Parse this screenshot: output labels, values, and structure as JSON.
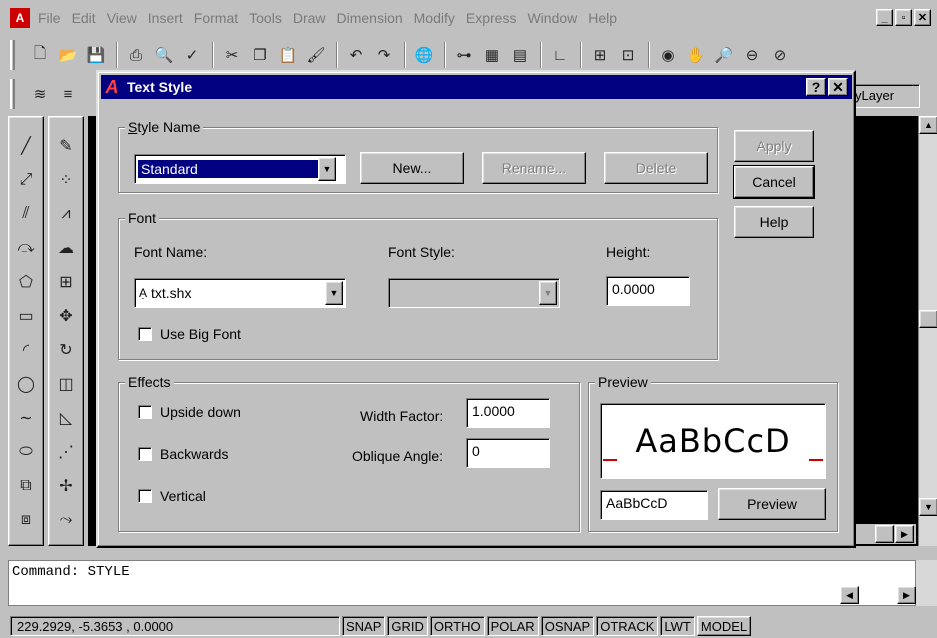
{
  "menubar": {
    "items": [
      "File",
      "Edit",
      "View",
      "Insert",
      "Format",
      "Tools",
      "Draw",
      "Dimension",
      "Modify",
      "Express",
      "Window",
      "Help"
    ],
    "window_buttons": [
      "_",
      "▫",
      "✕"
    ]
  },
  "layer_combo": {
    "value": "yLayer"
  },
  "dialog": {
    "title": "Text Style",
    "help_btn": "?",
    "close_btn": "✕",
    "style_name": {
      "group_label": "Style Name",
      "value": "Standard",
      "new_label": "New...",
      "rename_label": "Rename...",
      "delete_label": "Delete"
    },
    "side_buttons": {
      "apply": "Apply",
      "cancel": "Cancel",
      "help": "Help"
    },
    "font": {
      "group_label": "Font",
      "font_name_label": "Font Name:",
      "font_name_value": "txt.shx",
      "font_style_label": "Font Style:",
      "font_style_value": "",
      "height_label": "Height:",
      "height_value": "0.0000",
      "use_big_font_label": "Use Big Font",
      "use_big_font_checked": false
    },
    "effects": {
      "group_label": "Effects",
      "upside_down_label": "Upside down",
      "backwards_label": "Backwards",
      "vertical_label": "Vertical",
      "width_factor_label": "Width Factor:",
      "width_factor_value": "1.0000",
      "oblique_label": "Oblique Angle:",
      "oblique_value": "0"
    },
    "preview": {
      "group_label": "Preview",
      "sample_text": "AaBbCcD",
      "input_value": "AaBbCcD",
      "button_label": "Preview"
    }
  },
  "command": {
    "text": "Command:  STYLE"
  },
  "status": {
    "coords": "229.2929, -5.3653 , 0.0000",
    "modes": [
      "SNAP",
      "GRID",
      "ORTHO",
      "POLAR",
      "OSNAP",
      "OTRACK",
      "LWT",
      "MODEL"
    ]
  }
}
